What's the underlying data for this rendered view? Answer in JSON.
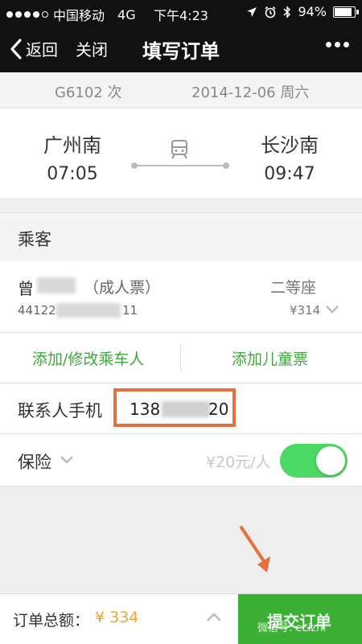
{
  "status_bar": {
    "carrier": "中国移动",
    "network": "4G",
    "time": "下午4:23",
    "battery": "94%",
    "battery_level": 0.94,
    "signal_bars_filled": 4,
    "signal_bars_total": 5
  },
  "nav": {
    "back_label": "返回",
    "close_label": "关闭",
    "title": "填写订单"
  },
  "trip": {
    "train_no": "G6102 次",
    "date": "2014-12-06 周六",
    "from_station": "广州南",
    "from_time": "07:05",
    "to_station": "长沙南",
    "to_time": "09:47"
  },
  "passengers_section": {
    "title": "乘客",
    "passenger": {
      "name_visible": "曾",
      "ticket_type": "（成人票）",
      "id_start": "44122",
      "id_end": "11",
      "seat_class": "二等座",
      "price": "¥314"
    },
    "add_edit_label": "添加/修改乘车人",
    "add_child_label": "添加儿童票"
  },
  "contact": {
    "label": "联系人手机",
    "phone_start": "138",
    "phone_end": "20"
  },
  "insurance": {
    "label": "保险",
    "fee": "¥20元/人",
    "enabled": true
  },
  "footer": {
    "total_label": "订单总额：",
    "total_amount": "¥ 334",
    "submit_label": "提交订单"
  },
  "watermark": "微信号: eLizhi",
  "colors": {
    "accent_green": "#3cb035",
    "toggle_green": "#4cd964",
    "highlight_orange": "#e5703d",
    "amount_orange": "#f0a42c",
    "link_green": "#3fa83a"
  }
}
